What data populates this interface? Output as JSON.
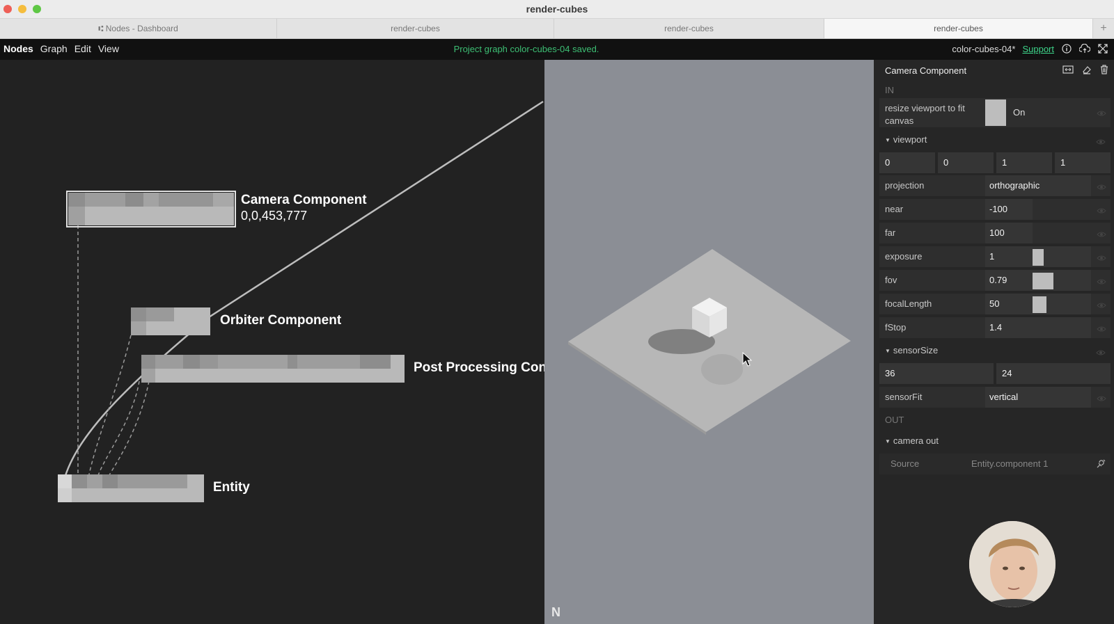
{
  "window": {
    "title": "render-cubes"
  },
  "tabs": [
    {
      "label": "⑆ Nodes - Dashboard"
    },
    {
      "label": "render-cubes"
    },
    {
      "label": "render-cubes"
    },
    {
      "label": "render-cubes"
    }
  ],
  "menu": {
    "items": [
      "Nodes",
      "Graph",
      "Edit",
      "View"
    ],
    "status": "Project graph color-cubes-04 saved.",
    "project_name": "color-cubes-04*",
    "support_label": "Support"
  },
  "graph": {
    "nodes": [
      {
        "label": "Camera Component",
        "sub": "0,0,453,777"
      },
      {
        "label": "Orbiter Component"
      },
      {
        "label": "Post Processing Con"
      },
      {
        "label": "Entity"
      }
    ]
  },
  "viewport": {
    "logo": "N"
  },
  "inspector": {
    "title": "Camera Component",
    "in_label": "IN",
    "out_label": "OUT",
    "resize_label_1": "resize viewport to fit",
    "resize_label_2": "canvas",
    "resize_value": "On",
    "viewport_group": "viewport",
    "viewport_values": [
      "0",
      "0",
      "1",
      "1"
    ],
    "projection_label": "projection",
    "projection_value": "orthographic",
    "near_label": "near",
    "near_value": "-100",
    "far_label": "far",
    "far_value": "100",
    "exposure_label": "exposure",
    "exposure_value": "1",
    "fov_label": "fov",
    "fov_value": "0.79",
    "focal_label": "focalLength",
    "focal_value": "50",
    "fstop_label": "fStop",
    "fstop_value": "1.4",
    "sensor_group": "sensorSize",
    "sensor_values": [
      "36",
      "24"
    ],
    "sensorfit_label": "sensorFit",
    "sensorfit_value": "vertical",
    "camera_out_group": "camera out",
    "source_label": "Source",
    "source_value": "Entity.component 1"
  },
  "colors": {
    "accent_green": "#3dbf74",
    "support_link": "#3dd58a"
  }
}
